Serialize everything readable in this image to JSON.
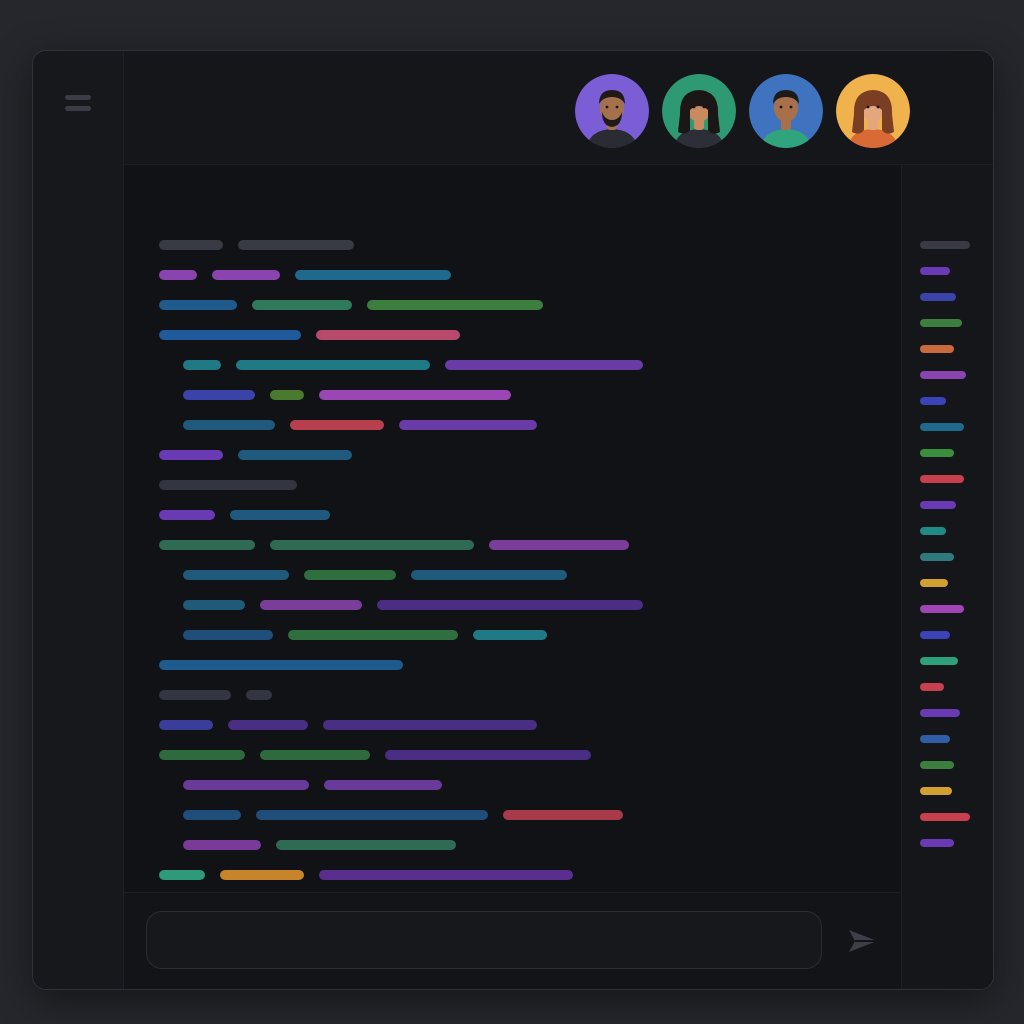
{
  "menu": {
    "icon": "hamburger-menu-icon"
  },
  "participants": [
    {
      "name_icon": "avatar-man-beard",
      "bg": "#7b5ed6",
      "skin": "#a5704c",
      "hair": "#1f1a18",
      "shirt": "#2a2c33"
    },
    {
      "name_icon": "avatar-woman-dark-hair",
      "bg": "#2e9a74",
      "skin": "#c98a5f",
      "hair": "#1b1716",
      "shirt": "#2c2f37"
    },
    {
      "name_icon": "avatar-man-short-hair",
      "bg": "#3f73bf",
      "skin": "#a8704a",
      "hair": "#1d1b1a",
      "shirt": "#2fa47d"
    },
    {
      "name_icon": "avatar-woman-brown-hair",
      "bg": "#f0b24c",
      "skin": "#e4a77d",
      "hair": "#7a3e23",
      "shirt": "#d96a35"
    }
  ],
  "code_lines": [
    {
      "indent": 0,
      "tokens": [
        {
          "w": 64,
          "color": "#383b44"
        },
        {
          "w": 116,
          "color": "#383b44"
        }
      ]
    },
    {
      "indent": 0,
      "tokens": [
        {
          "w": 38,
          "color": "#8a44b0"
        },
        {
          "w": 68,
          "color": "#8a44b0"
        },
        {
          "w": 156,
          "color": "#1f6a8c"
        }
      ]
    },
    {
      "indent": 0,
      "tokens": [
        {
          "w": 78,
          "color": "#1f5a8c"
        },
        {
          "w": 100,
          "color": "#2f7a5a"
        },
        {
          "w": 176,
          "color": "#3b7e3e"
        }
      ]
    },
    {
      "indent": 0,
      "tokens": [
        {
          "w": 142,
          "color": "#1f5a9a"
        },
        {
          "w": 144,
          "color": "#b84a6e"
        }
      ]
    },
    {
      "indent": 1,
      "tokens": [
        {
          "w": 38,
          "color": "#1f7a86"
        },
        {
          "w": 194,
          "color": "#1f7a86"
        },
        {
          "w": 198,
          "color": "#6a3aa6"
        }
      ]
    },
    {
      "indent": 1,
      "tokens": [
        {
          "w": 72,
          "color": "#3a44a8"
        },
        {
          "w": 34,
          "color": "#4a7a2e"
        },
        {
          "w": 192,
          "color": "#9a46b4"
        }
      ]
    },
    {
      "indent": 1,
      "tokens": [
        {
          "w": 92,
          "color": "#1f5a7e"
        },
        {
          "w": 94,
          "color": "#b8404e"
        },
        {
          "w": 138,
          "color": "#6a3aa6"
        }
      ]
    },
    {
      "indent": 0,
      "tokens": [
        {
          "w": 64,
          "color": "#6a3ab4"
        },
        {
          "w": 114,
          "color": "#1f5a7e"
        }
      ]
    },
    {
      "indent": 0,
      "tokens": [
        {
          "w": 138,
          "color": "#333640"
        }
      ]
    },
    {
      "indent": 0,
      "tokens": [
        {
          "w": 56,
          "color": "#6a3ab4"
        },
        {
          "w": 100,
          "color": "#1f5a7e"
        }
      ]
    },
    {
      "indent": 0,
      "tokens": [
        {
          "w": 96,
          "color": "#2f6a54"
        },
        {
          "w": 204,
          "color": "#2f6a54"
        },
        {
          "w": 140,
          "color": "#7a3e9a"
        }
      ]
    },
    {
      "indent": 1,
      "tokens": [
        {
          "w": 106,
          "color": "#1f5a7a"
        },
        {
          "w": 92,
          "color": "#2f6e3e"
        },
        {
          "w": 156,
          "color": "#1f5a7a"
        }
      ]
    },
    {
      "indent": 1,
      "tokens": [
        {
          "w": 62,
          "color": "#1f5a7a"
        },
        {
          "w": 102,
          "color": "#7a3e9a"
        },
        {
          "w": 266,
          "color": "#4a2e84"
        }
      ]
    },
    {
      "indent": 1,
      "tokens": [
        {
          "w": 90,
          "color": "#1f4e7a"
        },
        {
          "w": 170,
          "color": "#2f6e3e"
        },
        {
          "w": 74,
          "color": "#1f7a86"
        }
      ]
    },
    {
      "indent": 0,
      "tokens": [
        {
          "w": 244,
          "color": "#1f5a8c"
        }
      ]
    },
    {
      "indent": 0,
      "tokens": [
        {
          "w": 72,
          "color": "#333640"
        },
        {
          "w": 26,
          "color": "#333640"
        }
      ]
    },
    {
      "indent": 0,
      "tokens": [
        {
          "w": 54,
          "color": "#3a3e9a"
        },
        {
          "w": 80,
          "color": "#4a2e84"
        },
        {
          "w": 214,
          "color": "#4a2e84"
        }
      ]
    },
    {
      "indent": 0,
      "tokens": [
        {
          "w": 86,
          "color": "#2f6a3e"
        },
        {
          "w": 110,
          "color": "#2f6a3e"
        },
        {
          "w": 206,
          "color": "#4a2e84"
        }
      ]
    },
    {
      "indent": 1,
      "tokens": [
        {
          "w": 126,
          "color": "#6a3a9a"
        },
        {
          "w": 118,
          "color": "#6a3a9a"
        }
      ]
    },
    {
      "indent": 1,
      "tokens": [
        {
          "w": 58,
          "color": "#1f4e7a"
        },
        {
          "w": 232,
          "color": "#1f4e7a"
        },
        {
          "w": 120,
          "color": "#a83a4a"
        }
      ]
    },
    {
      "indent": 1,
      "tokens": [
        {
          "w": 78,
          "color": "#7a3a9a"
        },
        {
          "w": 180,
          "color": "#2f6a54"
        }
      ]
    },
    {
      "indent": 0,
      "tokens": [
        {
          "w": 46,
          "color": "#2e9a7a"
        },
        {
          "w": 84,
          "color": "#c8842a"
        },
        {
          "w": 254,
          "color": "#5a2e8e"
        }
      ]
    }
  ],
  "minimap": [
    {
      "w": 50,
      "color": "#383b44"
    },
    {
      "w": 30,
      "color": "#6a3ab4"
    },
    {
      "w": 36,
      "color": "#3a44a8"
    },
    {
      "w": 42,
      "color": "#3b7e3e"
    },
    {
      "w": 34,
      "color": "#c86a3e"
    },
    {
      "w": 46,
      "color": "#8a44b0"
    },
    {
      "w": 26,
      "color": "#3a44b8"
    },
    {
      "w": 44,
      "color": "#1f6a8c"
    },
    {
      "w": 34,
      "color": "#3b8e3e"
    },
    {
      "w": 44,
      "color": "#c8404e"
    },
    {
      "w": 36,
      "color": "#6a3ab4"
    },
    {
      "w": 26,
      "color": "#1f8a86"
    },
    {
      "w": 34,
      "color": "#2f7a7e"
    },
    {
      "w": 28,
      "color": "#d0a030"
    },
    {
      "w": 44,
      "color": "#a046b4"
    },
    {
      "w": 30,
      "color": "#3a44b8"
    },
    {
      "w": 38,
      "color": "#2ea07a"
    },
    {
      "w": 24,
      "color": "#c8404e"
    },
    {
      "w": 40,
      "color": "#6a3ab4"
    },
    {
      "w": 30,
      "color": "#2f5ea6"
    },
    {
      "w": 34,
      "color": "#3b7e3e"
    },
    {
      "w": 32,
      "color": "#d0a030"
    },
    {
      "w": 50,
      "color": "#c8404e"
    },
    {
      "w": 34,
      "color": "#6a3ab4"
    }
  ],
  "composer": {
    "placeholder": "",
    "value": "",
    "send_icon": "send-arrow-icon"
  }
}
